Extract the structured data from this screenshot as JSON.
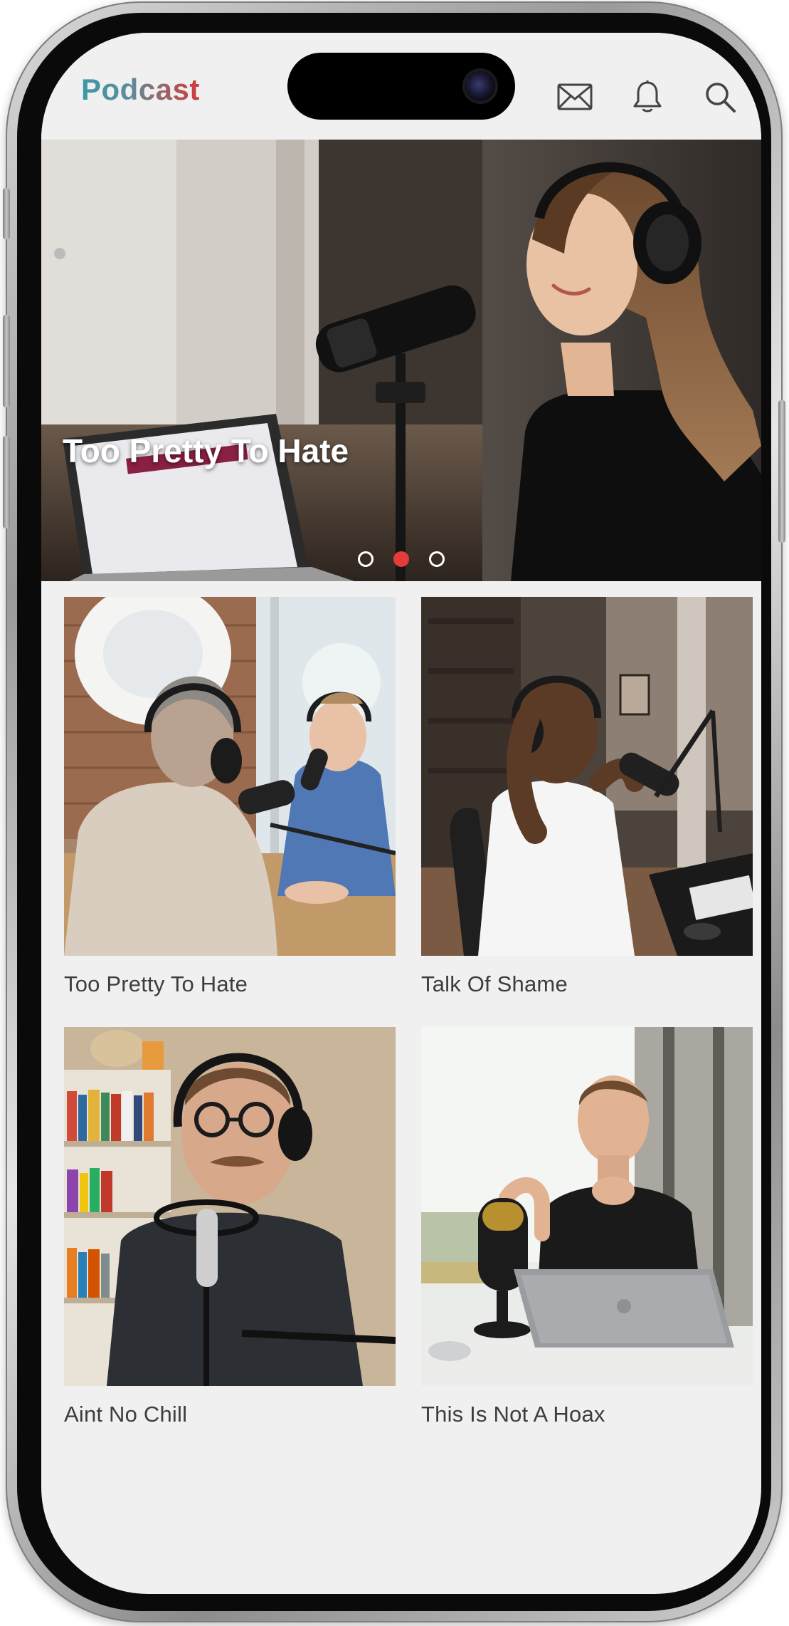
{
  "app": {
    "title": "Podcast",
    "brand_colors": {
      "teal": "#3a9aa5",
      "red": "#d23b3b"
    }
  },
  "header": {
    "icons": [
      "mail-icon",
      "bell-icon",
      "search-icon"
    ]
  },
  "hero": {
    "title": "Too Pretty To Hate",
    "slides_total": 3,
    "active_slide": 2,
    "active_dot_color": "#e53b3b"
  },
  "podcasts": [
    {
      "title": "Too Pretty To Hate"
    },
    {
      "title": "Talk Of Shame"
    },
    {
      "title": "Aint No Chill"
    },
    {
      "title": "This Is Not A Hoax"
    }
  ]
}
